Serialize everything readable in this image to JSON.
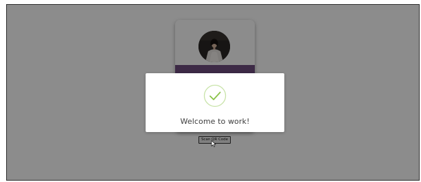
{
  "profile": {
    "photo_icon": "woman-portrait-photo",
    "band_color": "#6f4d80"
  },
  "scan_button": {
    "label": "Scan QR Code"
  },
  "dialog": {
    "icon": "check-circle-icon",
    "icon_color": "#8bc34a",
    "message": "Welcome to work!"
  },
  "overlay": {
    "color": "#000000",
    "opacity": 0.45
  }
}
